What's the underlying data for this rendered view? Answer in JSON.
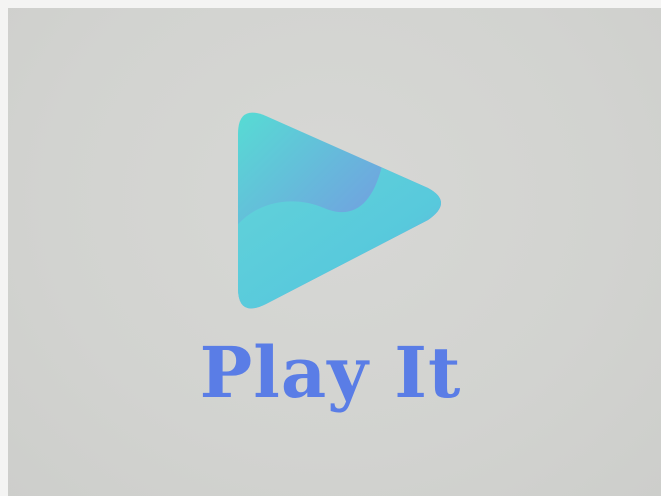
{
  "logo": {
    "wordmark": "Play It",
    "icon": "play-triangle-icon",
    "colors": {
      "background": "#d3d4d1",
      "wordmark": "#5a7de6",
      "triangle_top": "#5bd6d4",
      "triangle_mid": "#7b8fe0",
      "triangle_bottom": "#5fcfd8"
    }
  }
}
